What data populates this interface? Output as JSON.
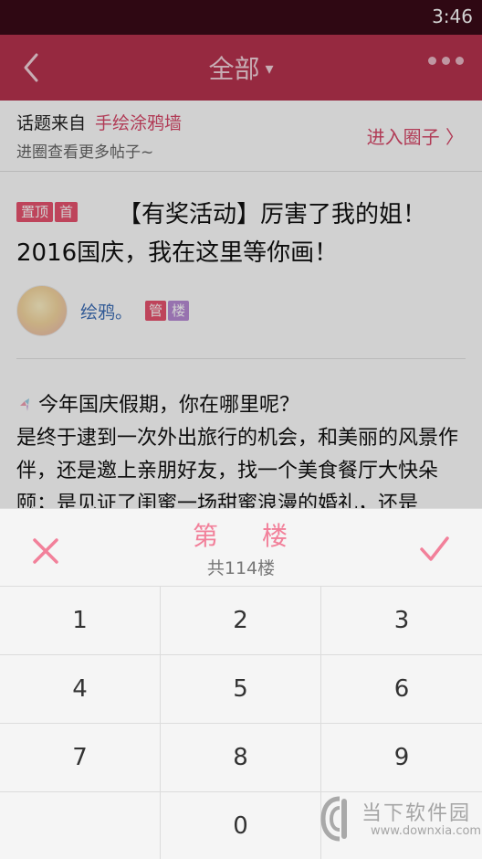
{
  "status_bar": {
    "time": "3:46"
  },
  "app_bar": {
    "title": "全部",
    "caret": "▾"
  },
  "topic": {
    "from_label": "话题来自",
    "circle_name": "手绘涂鸦墙",
    "subtitle": "进圈查看更多帖子~",
    "enter_label": "进入圈子 〉"
  },
  "post": {
    "badge_top": "置顶",
    "badge_first": "首",
    "title": "【有奖活动】厉害了我的姐！2016国庆，我在这里等你画！",
    "author": "绘鸦。",
    "badge_admin": "管",
    "badge_floor": "楼",
    "body": "今年国庆假期，你在哪里呢？\n是终于逮到一次外出旅行的机会，和美丽的风景作伴，还是邀上亲朋好友，找一个美食餐厅大快朵颐；是见证了闺蜜一场甜蜜浪漫的婚礼，还是"
  },
  "picker": {
    "label_left": "第",
    "label_right": "楼",
    "total": "共114楼",
    "keys": [
      "1",
      "2",
      "3",
      "4",
      "5",
      "6",
      "7",
      "8",
      "9",
      "",
      "0",
      ""
    ]
  },
  "watermark": {
    "cn": "当下软件园",
    "en": "www.downxia.com"
  },
  "colors": {
    "accent": "#b8334f",
    "pink": "#f2809a",
    "link": "#3f6fb7"
  }
}
